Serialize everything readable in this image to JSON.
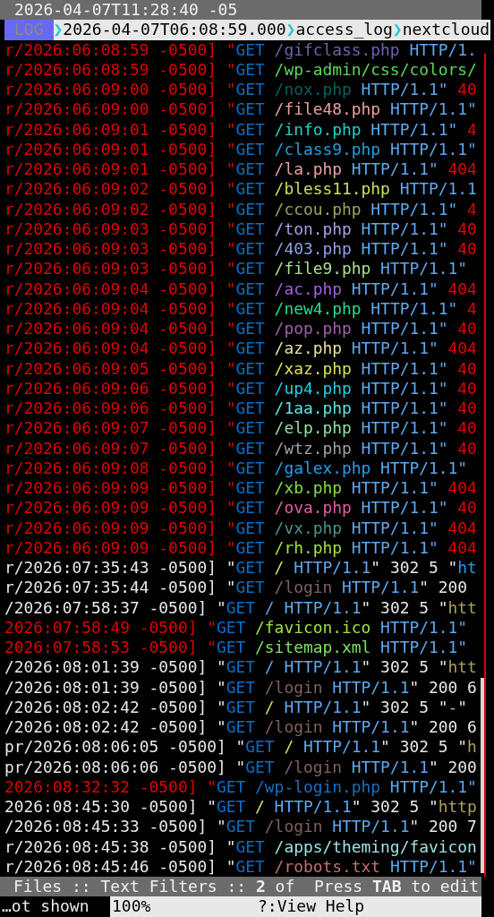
{
  "top_bar": {
    "clock": "2026-04-07T11:28:40 -05"
  },
  "breadcrumb": {
    "badge": "LOG",
    "crumbs": [
      {
        "separator": "❯",
        "text": "2026-04-07T06:08:59.000"
      },
      {
        "separator": "❯",
        "text": "access_log"
      },
      {
        "separator": "❯",
        "text": "nextcloud"
      }
    ]
  },
  "log_lines": [
    {
      "time": "r/2026:06:08:59 -0500] \"",
      "error": true,
      "method": "GET",
      "path": {
        "text": "/gifclass.php",
        "color": "#6a64b0"
      },
      "protocol": "HTTP/1."
    },
    {
      "time": "r/2026:06:08:59 -0500] \"",
      "error": true,
      "method": "GET",
      "path": {
        "text": "/wp-admin/css/colors/",
        "color": "#5ad85a"
      }
    },
    {
      "time": "r/2026:06:09:00 -0500] \"",
      "error": true,
      "method": "GET",
      "path": {
        "text": "/nox.php",
        "color": "#0a6060"
      },
      "protocol": "HTTP/1.1\"",
      "tail": [
        {
          "text": " 40",
          "color": "#e00000"
        }
      ]
    },
    {
      "time": "r/2026:06:09:00 -0500] \"",
      "error": true,
      "method": "GET",
      "path": {
        "text": "/file48.php",
        "color": "#e8a0a0"
      },
      "protocol": "HTTP/1.1\""
    },
    {
      "time": "r/2026:06:09:01 -0500] \"",
      "error": true,
      "method": "GET",
      "path": {
        "text": "/info.php",
        "color": "#20d0d0"
      },
      "protocol": "HTTP/1.1\"",
      "tail": [
        {
          "text": " 4",
          "color": "#e00000"
        }
      ]
    },
    {
      "time": "r/2026:06:09:01 -0500] \"",
      "error": true,
      "method": "GET",
      "path": {
        "text": "/class9.php",
        "color": "#20a0e0"
      },
      "protocol": "HTTP/1.1\""
    },
    {
      "time": "r/2026:06:09:01 -0500] \"",
      "error": true,
      "method": "GET",
      "path": {
        "text": "/la.php",
        "color": "#e8a0a0"
      },
      "protocol": "HTTP/1.1\"",
      "tail": [
        {
          "text": " 404",
          "color": "#e00000"
        }
      ]
    },
    {
      "time": "r/2026:06:09:02 -0500] \"",
      "error": true,
      "method": "GET",
      "path": {
        "text": "/bless11.php",
        "color": "#c8e060"
      },
      "protocol": "HTTP/1.1"
    },
    {
      "time": "r/2026:06:09:02 -0500] \"",
      "error": true,
      "method": "GET",
      "path": {
        "text": "/ccou.php",
        "color": "#90a860"
      },
      "protocol": "HTTP/1.1\"",
      "tail": [
        {
          "text": " 4",
          "color": "#e00000"
        }
      ]
    },
    {
      "time": "r/2026:06:09:03 -0500] \"",
      "error": true,
      "method": "GET",
      "path": {
        "text": "/ton.php",
        "color": "#a8a0e0"
      },
      "protocol": "HTTP/1.1\"",
      "tail": [
        {
          "text": " 40",
          "color": "#e00000"
        }
      ]
    },
    {
      "time": "r/2026:06:09:03 -0500] \"",
      "error": true,
      "method": "GET",
      "path": {
        "text": "/403.php",
        "color": "#90a0e8"
      },
      "protocol": "HTTP/1.1\"",
      "tail": [
        {
          "text": " 40",
          "color": "#e00000"
        }
      ]
    },
    {
      "time": "r/2026:06:09:03 -0500] \"",
      "error": true,
      "method": "GET",
      "path": {
        "text": "/file9.php",
        "color": "#a8e090"
      },
      "protocol": "HTTP/1.1\""
    },
    {
      "time": "r/2026:06:09:04 -0500] \"",
      "error": true,
      "method": "GET",
      "path": {
        "text": "/ac.php",
        "color": "#a060e0"
      },
      "protocol": "HTTP/1.1\"",
      "tail": [
        {
          "text": " 404",
          "color": "#e00000"
        }
      ]
    },
    {
      "time": "r/2026:06:09:04 -0500] \"",
      "error": true,
      "method": "GET",
      "path": {
        "text": "/new4.php",
        "color": "#20e090"
      },
      "protocol": "HTTP/1.1\"",
      "tail": [
        {
          "text": " 4",
          "color": "#e00000"
        }
      ]
    },
    {
      "time": "r/2026:06:09:04 -0500] \"",
      "error": true,
      "method": "GET",
      "path": {
        "text": "/pop.php",
        "color": "#a060a8"
      },
      "protocol": "HTTP/1.1\"",
      "tail": [
        {
          "text": " 40",
          "color": "#e00000"
        }
      ]
    },
    {
      "time": "r/2026:06:09:04 -0500] \"",
      "error": true,
      "method": "GET",
      "path": {
        "text": "/az.php",
        "color": "#e8e0a0"
      },
      "protocol": "HTTP/1.1\"",
      "tail": [
        {
          "text": " 404",
          "color": "#e00000"
        }
      ]
    },
    {
      "time": "r/2026:06:09:05 -0500] \"",
      "error": true,
      "method": "GET",
      "path": {
        "text": "/xaz.php",
        "color": "#d8e060"
      },
      "protocol": "HTTP/1.1\"",
      "tail": [
        {
          "text": " 40",
          "color": "#e00000"
        }
      ]
    },
    {
      "time": "r/2026:06:09:06 -0500] \"",
      "error": true,
      "method": "GET",
      "path": {
        "text": "/up4.php",
        "color": "#20d0e8"
      },
      "protocol": "HTTP/1.1\"",
      "tail": [
        {
          "text": " 40",
          "color": "#e00000"
        }
      ]
    },
    {
      "time": "r/2026:06:09:06 -0500] \"",
      "error": true,
      "method": "GET",
      "path": {
        "text": "/1aa.php",
        "color": "#60e0e0"
      },
      "protocol": "HTTP/1.1\"",
      "tail": [
        {
          "text": " 40",
          "color": "#e00000"
        }
      ]
    },
    {
      "time": "r/2026:06:09:07 -0500] \"",
      "error": true,
      "method": "GET",
      "path": {
        "text": "/elp.php",
        "color": "#90e0a0"
      },
      "protocol": "HTTP/1.1\"",
      "tail": [
        {
          "text": " 40",
          "color": "#e00000"
        }
      ]
    },
    {
      "time": "r/2026:06:09:07 -0500] \"",
      "error": true,
      "method": "GET",
      "path": {
        "text": "/wtz.php",
        "color": "#a0a0a0"
      },
      "protocol": "HTTP/1.1\"",
      "tail": [
        {
          "text": " 40",
          "color": "#e00000"
        }
      ]
    },
    {
      "time": "r/2026:06:09:08 -0500] \"",
      "error": true,
      "method": "GET",
      "path": {
        "text": "/galex.php",
        "color": "#20a0e8"
      },
      "protocol": "HTTP/1.1\""
    },
    {
      "time": "r/2026:06:09:09 -0500] \"",
      "error": true,
      "method": "GET",
      "path": {
        "text": "/xb.php",
        "color": "#80e040"
      },
      "protocol": "HTTP/1.1\"",
      "tail": [
        {
          "text": " 404",
          "color": "#e00000"
        }
      ]
    },
    {
      "time": "r/2026:06:09:09 -0500] \"",
      "error": true,
      "method": "GET",
      "path": {
        "text": "/ova.php",
        "color": "#e060a0"
      },
      "protocol": "HTTP/1.1\"",
      "tail": [
        {
          "text": " 40",
          "color": "#e00000"
        }
      ]
    },
    {
      "time": "r/2026:06:09:09 -0500] \"",
      "error": true,
      "method": "GET",
      "path": {
        "text": "/vx.php",
        "color": "#509090"
      },
      "protocol": "HTTP/1.1\"",
      "tail": [
        {
          "text": " 404",
          "color": "#e00000"
        }
      ]
    },
    {
      "time": "r/2026:06:09:09 -0500] \"",
      "error": true,
      "method": "GET",
      "path": {
        "text": "/rh.php",
        "color": "#a0e040"
      },
      "protocol": "HTTP/1.1\"",
      "tail": [
        {
          "text": " 404",
          "color": "#e00000"
        }
      ]
    },
    {
      "time": "r/2026:07:35:43 -0500] \"",
      "error": false,
      "method": "GET",
      "path": {
        "text": "/",
        "color": "#d0e060"
      },
      "protocol": "HTTP/1.1",
      "tail": [
        {
          "text": "\" 302 5 \"",
          "color": "#e8e8e8"
        },
        {
          "text": "ht",
          "color": "#20a0e8"
        }
      ]
    },
    {
      "time": "r/2026:07:35:44 -0500] \"",
      "error": false,
      "method": "GET",
      "path": {
        "text": "/login",
        "color": "#806060"
      },
      "protocol": "HTTP/1.1",
      "tail": [
        {
          "text": "\" 200",
          "color": "#e8e8e8"
        }
      ]
    },
    {
      "time": "/2026:07:58:37 -0500] \"",
      "error": false,
      "method": "GET",
      "path": {
        "text": "/",
        "color": "#5ea8f0"
      },
      "protocol": "HTTP/1.1",
      "tail": [
        {
          "text": "\" 302 5 \"",
          "color": "#e8e8e8"
        },
        {
          "text": "htt",
          "color": "#a8a060"
        }
      ]
    },
    {
      "time": "2026:07:58:49 -0500] \"",
      "error": true,
      "method": "GET",
      "path": {
        "text": "/favicon.ico",
        "color": "#a0e040"
      },
      "protocol": "HTTP/1.1\""
    },
    {
      "time": "2026:07:58:53 -0500] \"",
      "error": true,
      "method": "GET",
      "path": {
        "text": "/sitemap.xml",
        "color": "#80e060"
      },
      "protocol": "HTTP/1.1\""
    },
    {
      "time": "/2026:08:01:39 -0500] \"",
      "error": false,
      "method": "GET",
      "path": {
        "text": "/",
        "color": "#5ea8f0"
      },
      "protocol": "HTTP/1.1",
      "tail": [
        {
          "text": "\" 302 5 \"",
          "color": "#e8e8e8"
        },
        {
          "text": "htt",
          "color": "#a8a060"
        }
      ]
    },
    {
      "time": "/2026:08:01:39 -0500] \"",
      "error": false,
      "method": "GET",
      "path": {
        "text": "/login",
        "color": "#806060"
      },
      "protocol": "HTTP/1.1",
      "tail": [
        {
          "text": "\" 200 6",
          "color": "#e8e8e8"
        }
      ]
    },
    {
      "time": "/2026:08:02:42 -0500] \"",
      "error": false,
      "method": "GET",
      "path": {
        "text": "/",
        "color": "#d0e060"
      },
      "protocol": "HTTP/1.1",
      "tail": [
        {
          "text": "\" 302 5 \"",
          "color": "#e8e8e8"
        },
        {
          "text": "-",
          "color": "#80d0d0"
        },
        {
          "text": "\"",
          "color": "#e8e8e8"
        }
      ]
    },
    {
      "time": "/2026:08:02:42 -0500] \"",
      "error": false,
      "method": "GET",
      "path": {
        "text": "/login",
        "color": "#806060"
      },
      "protocol": "HTTP/1.1",
      "tail": [
        {
          "text": "\" 200 6",
          "color": "#e8e8e8"
        }
      ]
    },
    {
      "time": "pr/2026:08:06:05 -0500] \"",
      "error": false,
      "method": "GET",
      "path": {
        "text": "/",
        "color": "#d0e060"
      },
      "protocol": "HTTP/1.1",
      "tail": [
        {
          "text": "\" 302 5 \"",
          "color": "#e8e8e8"
        },
        {
          "text": "h",
          "color": "#a8a060"
        }
      ]
    },
    {
      "time": "pr/2026:08:06:06 -0500] \"",
      "error": false,
      "method": "GET",
      "path": {
        "text": "/login",
        "color": "#806060"
      },
      "protocol": "HTTP/1.1",
      "tail": [
        {
          "text": "\" 200",
          "color": "#e8e8e8"
        }
      ]
    },
    {
      "time": "2026:08:32:32 -0500] \"",
      "error": true,
      "method": "GET",
      "path": {
        "text": "/wp-login.php",
        "color": "#1a6fc4"
      },
      "protocol": "HTTP/1.1\""
    },
    {
      "time": "2026:08:45:30 -0500] \"",
      "error": false,
      "method": "GET",
      "path": {
        "text": "/",
        "color": "#d0e060"
      },
      "protocol": "HTTP/1.1",
      "tail": [
        {
          "text": "\" 302 5 \"",
          "color": "#e8e8e8"
        },
        {
          "text": "http",
          "color": "#a8a060"
        }
      ]
    },
    {
      "time": "/2026:08:45:33 -0500] \"",
      "error": false,
      "method": "GET",
      "path": {
        "text": "/login",
        "color": "#806060"
      },
      "protocol": "HTTP/1.1",
      "tail": [
        {
          "text": "\" 200 7",
          "color": "#e8e8e8"
        }
      ]
    },
    {
      "time": "r/2026:08:45:38 -0500] \"",
      "error": false,
      "method": "GET",
      "path": {
        "text": "/apps/theming/favicon",
        "color": "#a0e0e0"
      }
    },
    {
      "time": "r/2026:08:45:46 -0500] \"",
      "error": false,
      "method": "GET",
      "path": {
        "text": "/robots.txt",
        "color": "#c07070"
      },
      "protocol": "HTTP/1.1\""
    }
  ],
  "status_bar": {
    "text": "Files :: Text Filters :: **2** of  Press **TAB** to edit"
  },
  "bottom_bar": {
    "note": "…ot shown",
    "percent": "100%",
    "help": "?:View Help"
  }
}
